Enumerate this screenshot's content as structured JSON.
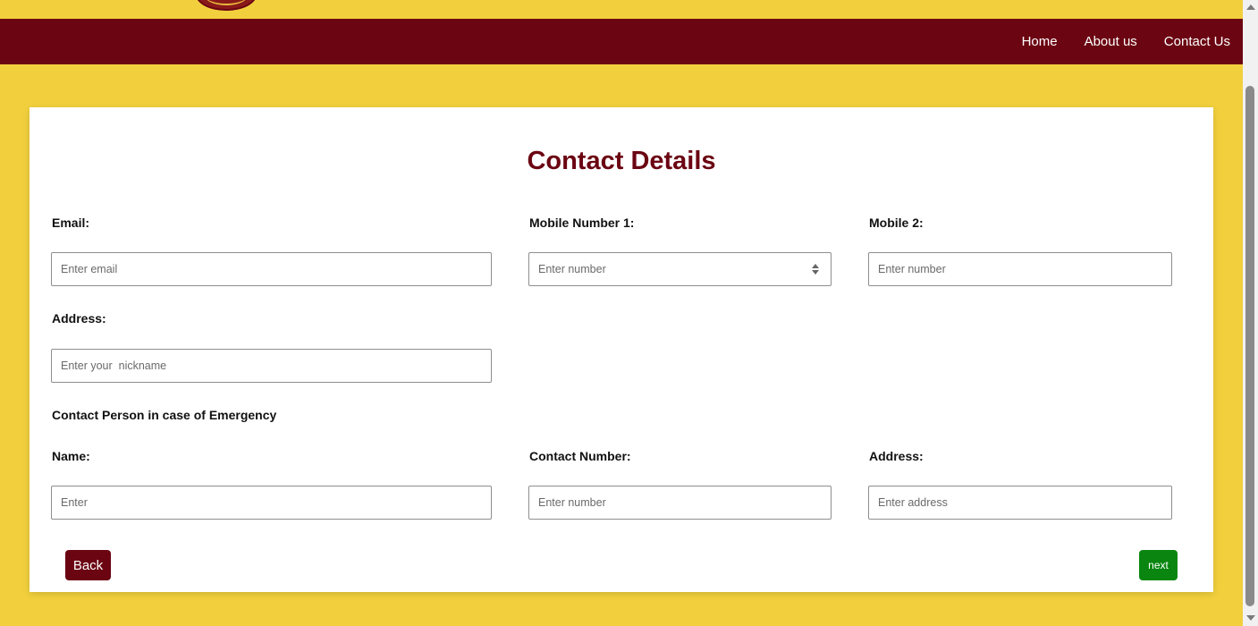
{
  "nav": {
    "items": [
      "Home",
      "About us",
      "Contact Us"
    ]
  },
  "form": {
    "title": "Contact Details",
    "email": {
      "label": "Email:",
      "placeholder": "Enter email"
    },
    "mobile1": {
      "label": "Mobile Number 1:",
      "placeholder": "Enter number"
    },
    "mobile2": {
      "label": "Mobile 2:",
      "placeholder": "Enter number"
    },
    "address": {
      "label": "Address:",
      "placeholder": "Enter your  nickname"
    },
    "emergency_heading": "Contact Person in case of Emergency",
    "em_name": {
      "label": "Name:",
      "placeholder": "Enter"
    },
    "em_contact": {
      "label": "Contact Number:",
      "placeholder": "Enter number"
    },
    "em_address": {
      "label": "Address:",
      "placeholder": "Enter address"
    },
    "back_label": "Back",
    "next_label": "next"
  },
  "colors": {
    "page_background": "#f2d03d",
    "brand_maroon": "#6b0512",
    "next_green": "#0a8610"
  },
  "icons": {
    "logo": "emblem-logo",
    "number_spinner": "spinner-arrows-icon"
  }
}
